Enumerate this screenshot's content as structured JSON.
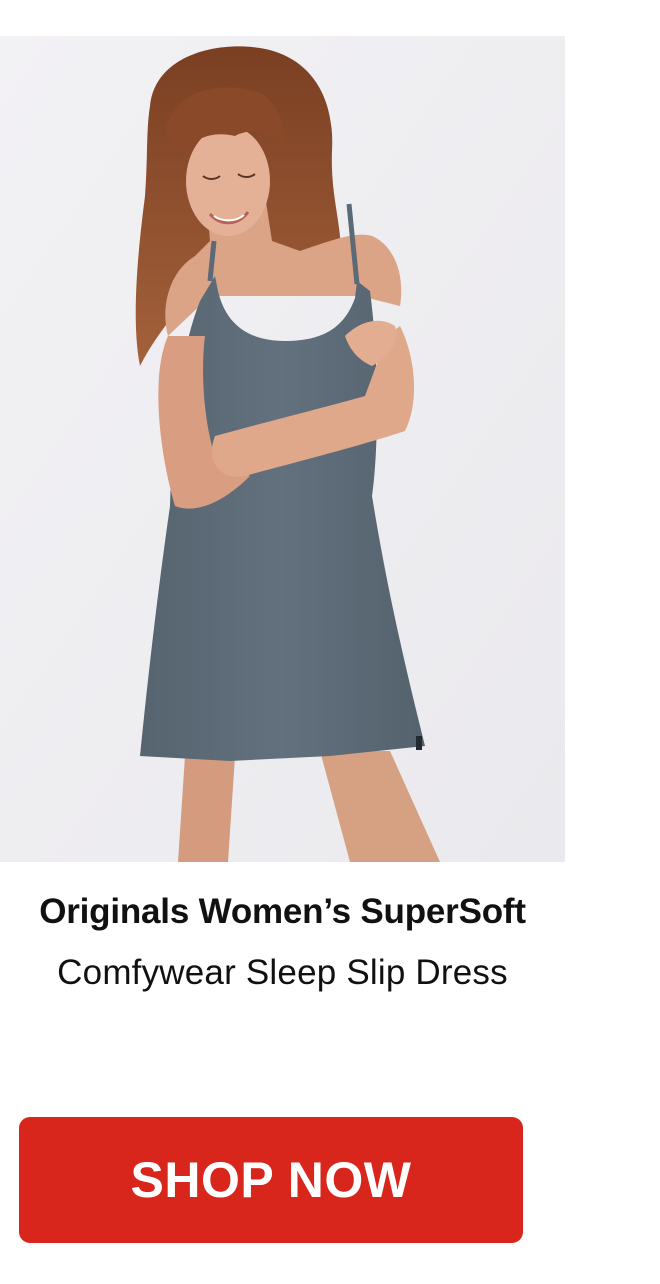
{
  "product": {
    "image_alt": "Woman wearing a slate grey sleep slip dress",
    "title_line_1": "Originals Women’s SuperSoft",
    "title_line_2": "Comfywear Sleep Slip Dress"
  },
  "cta": {
    "label": "SHOP NOW"
  },
  "colors": {
    "image_background": "#efeef1",
    "dress": "#5b6a76",
    "button": "#d9261c",
    "button_text": "#ffffff",
    "title_text": "#111111"
  }
}
